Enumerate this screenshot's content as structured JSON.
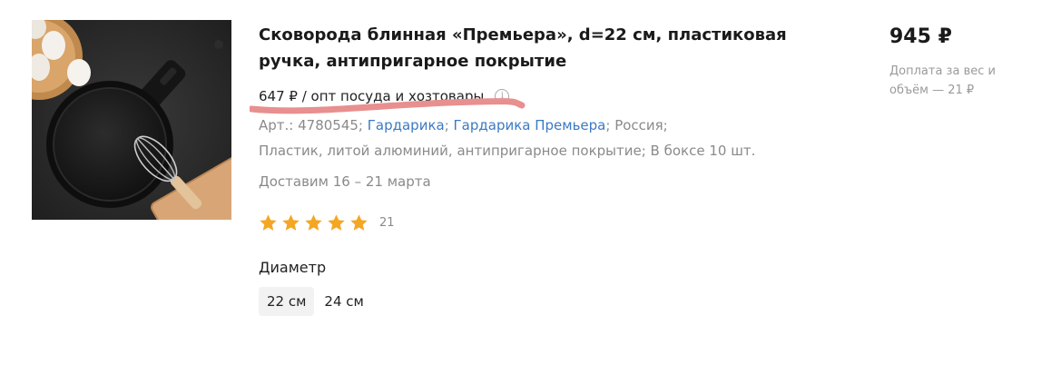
{
  "product": {
    "title": "Сковорода блинная «Премьера», d=22 см, пластиковая ручка, антипригарное покрытие",
    "wholesale_price": "647 ₽ / опт посуда и хозтовары",
    "info_icon": "i",
    "article_prefix": "Арт.: 4780545; ",
    "brand_link_1": "Гардарика",
    "sep_1": "; ",
    "brand_link_2": "Гардарика Премьера",
    "country": "; Россия;",
    "materials": "Пластик, литой алюминий, антипригарное покрытие; В боксе 10 шт.",
    "delivery": "Доставим 16 – 21 марта",
    "rating_count": "21",
    "rating_stars": 5,
    "rating_color": "#f5a623"
  },
  "options": {
    "label": "Диаметр",
    "values": [
      "22 см",
      "24 см"
    ],
    "selected": "22 см"
  },
  "price": {
    "value": "945 ₽",
    "surcharge": "Доплата за вес и объём — 21 ₽"
  },
  "colors": {
    "link": "#3b7ac3",
    "annotation": "#e88f8f"
  }
}
